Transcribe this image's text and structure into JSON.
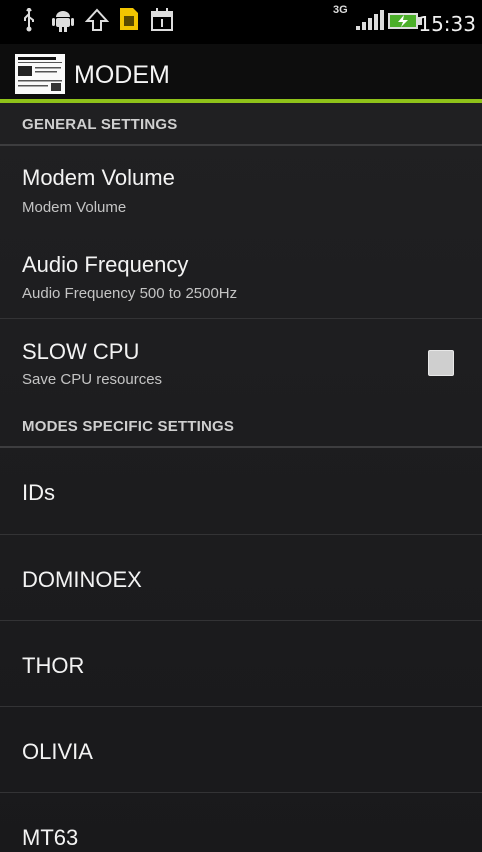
{
  "status_bar": {
    "time": "15:33",
    "network": "3G",
    "icons": [
      "usb-icon",
      "android-debug-icon",
      "upload-icon",
      "sim-card-icon",
      "calendar-icon",
      "network-3g-icon",
      "signal-bars-icon",
      "battery-charging-icon"
    ]
  },
  "app_bar": {
    "title": "MODEM",
    "icon": "app-logo-icon",
    "accent_color": "#8fc21a"
  },
  "sections": {
    "general": {
      "header": "GENERAL SETTINGS",
      "items": [
        {
          "title": "Modem Volume",
          "summary": "Modem Volume"
        },
        {
          "title": "Audio Frequency",
          "summary": "Audio Frequency 500 to 2500Hz"
        },
        {
          "title": "SLOW CPU",
          "summary": "Save CPU resources",
          "checked": false
        }
      ]
    },
    "modes": {
      "header": "MODES SPECIFIC SETTINGS",
      "items": [
        {
          "title": "IDs"
        },
        {
          "title": "DOMINOEX"
        },
        {
          "title": "THOR"
        },
        {
          "title": "OLIVIA"
        },
        {
          "title": "MT63"
        }
      ]
    }
  }
}
